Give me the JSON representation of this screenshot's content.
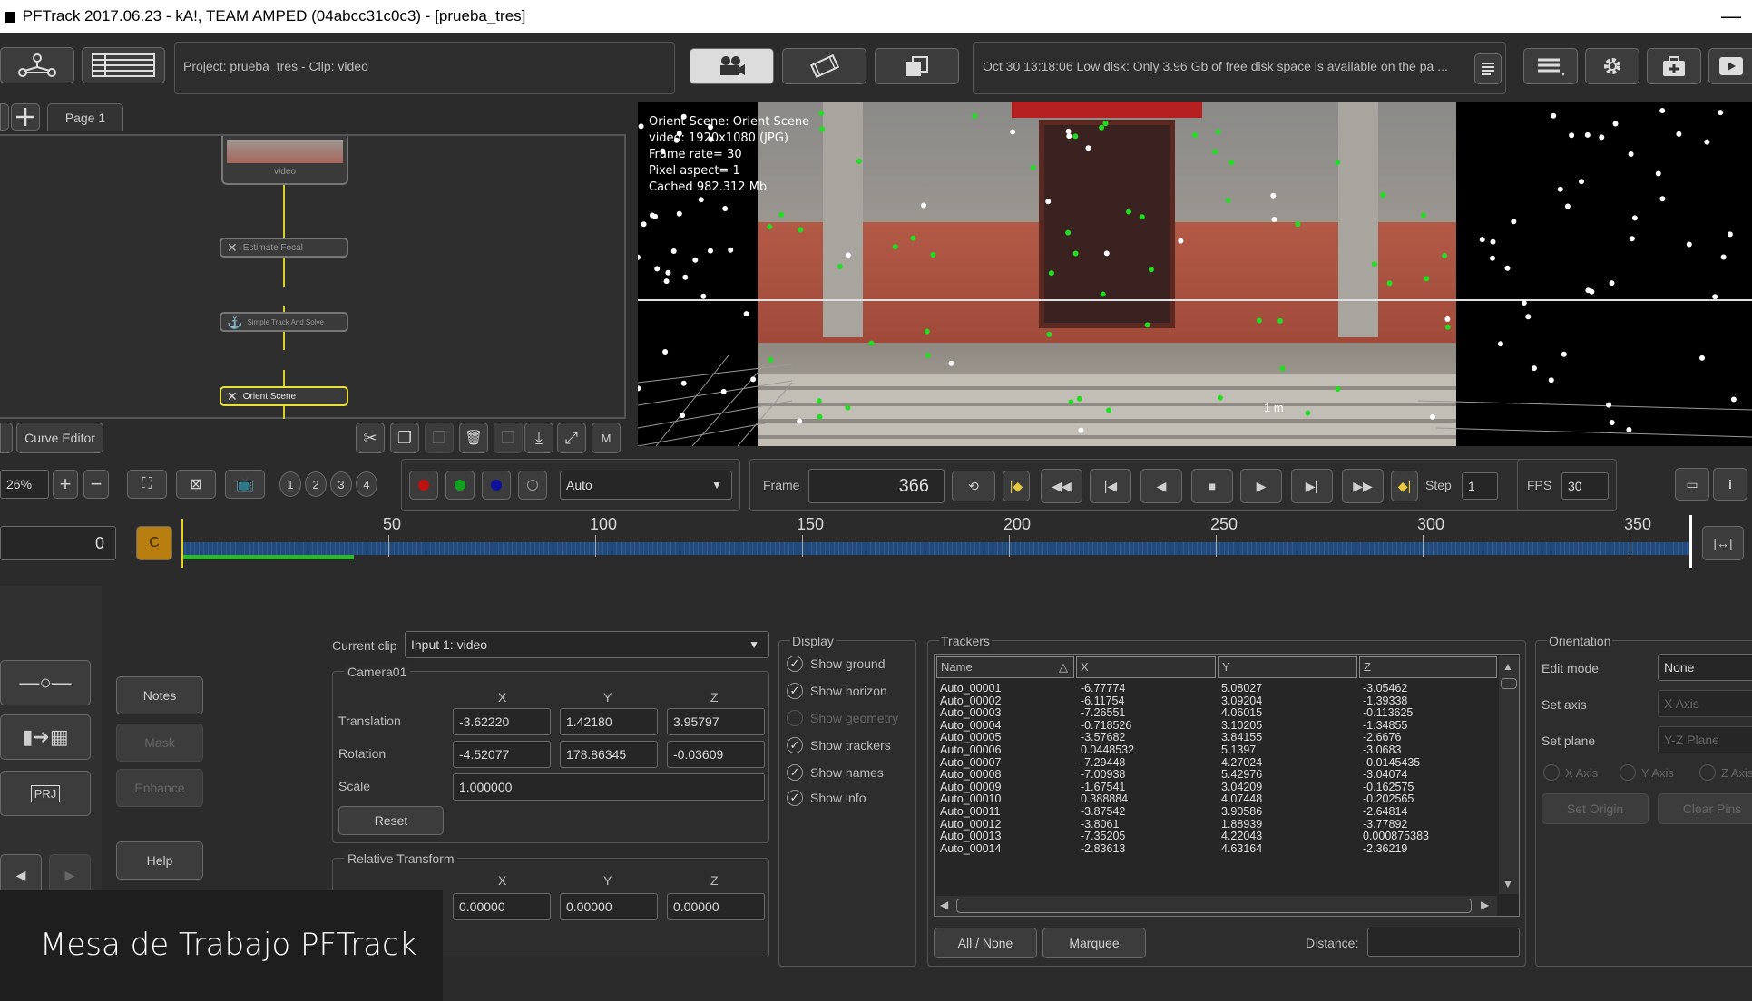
{
  "window": {
    "title": "PFTrack 2017.06.23 - kA!, TEAM AMPED (04abcc31c0c3) - [prueba_tres]",
    "close_glyph": "—"
  },
  "toolbar": {
    "project_info": "Project: prueba_tres - Clip: video",
    "status_message": "Oct 30 13:18:06 Low disk: Only 3.96 Gb of free disk space is available on the pa ..."
  },
  "node_editor": {
    "tab_label": "Page 1",
    "nodes": [
      "video",
      "Estimate Focal",
      "Simple Track And Solve",
      "Orient Scene"
    ],
    "curve_editor_label": "Curve Editor",
    "menu_label": "M"
  },
  "viewport": {
    "info_lines": [
      "Orient Scene: Orient Scene",
      "video: 1920x1080 (JPG)",
      "Frame rate= 30",
      "Pixel aspect= 1",
      "Cached 982.312 Mb"
    ],
    "scale_label": "1 m"
  },
  "transport": {
    "zoom": "26%",
    "layouts": [
      "1",
      "2",
      "3",
      "4"
    ],
    "display_mode": "Auto",
    "frame_label": "Frame",
    "frame_value": "366",
    "step_label": "Step",
    "step_value": "1",
    "fps_label": "FPS",
    "fps_value": "30"
  },
  "timeline": {
    "start_value": "0",
    "cache_button": "C",
    "ticks": [
      "50",
      "100",
      "150",
      "200",
      "250",
      "300",
      "350"
    ]
  },
  "left_buttons": {
    "notes": "Notes",
    "mask": "Mask",
    "enhance": "Enhance",
    "help": "Help",
    "prj": "PRJ"
  },
  "clip_panel": {
    "current_clip_label": "Current clip",
    "current_clip_value": "Input 1: video",
    "camera_group": "Camera01",
    "axes": [
      "X",
      "Y",
      "Z"
    ],
    "translation_label": "Translation",
    "translation": [
      "-3.62220",
      "1.42180",
      "3.95797"
    ],
    "rotation_label": "Rotation",
    "rotation": [
      "-4.52077",
      "178.86345",
      "-0.03609"
    ],
    "scale_label": "Scale",
    "scale": "1.000000",
    "reset_label": "Reset",
    "relative_group": "Relative Transform",
    "relative": [
      "0.00000",
      "0.00000",
      "0.00000"
    ]
  },
  "display_panel": {
    "title": "Display",
    "options": [
      {
        "label": "Show ground",
        "checked": true
      },
      {
        "label": "Show horizon",
        "checked": true
      },
      {
        "label": "Show geometry",
        "checked": false
      },
      {
        "label": "Show trackers",
        "checked": true
      },
      {
        "label": "Show names",
        "checked": true
      },
      {
        "label": "Show info",
        "checked": true
      }
    ]
  },
  "trackers_panel": {
    "title": "Trackers",
    "columns": [
      "Name",
      "X",
      "Y",
      "Z"
    ],
    "rows": [
      [
        "Auto_00001",
        "-6.77774",
        "5.08027",
        "-3.05462"
      ],
      [
        "Auto_00002",
        "-6.11754",
        "3.09204",
        "-1.39338"
      ],
      [
        "Auto_00003",
        "-7.26551",
        "4.06015",
        "-0.113625"
      ],
      [
        "Auto_00004",
        "-0.718526",
        "3.10205",
        "-1.34855"
      ],
      [
        "Auto_00005",
        "-3.57682",
        "3.84155",
        "-2.6676"
      ],
      [
        "Auto_00006",
        "0.0448532",
        "5.1397",
        "-3.0683"
      ],
      [
        "Auto_00007",
        "-7.29448",
        "4.27024",
        "-0.0145435"
      ],
      [
        "Auto_00008",
        "-7.00938",
        "5.42976",
        "-3.04074"
      ],
      [
        "Auto_00009",
        "-1.67541",
        "3.04209",
        "-0.162575"
      ],
      [
        "Auto_00010",
        "0.388884",
        "4.07448",
        "-0.202565"
      ],
      [
        "Auto_00011",
        "-3.87542",
        "3.90586",
        "-2.64814"
      ],
      [
        "Auto_00012",
        "-3.8061",
        "1.88939",
        "-3.77892"
      ],
      [
        "Auto_00013",
        "-7.35205",
        "4.22043",
        "0.000875383"
      ],
      [
        "Auto_00014",
        "-2.83613",
        "4.63164",
        "-2.36219"
      ]
    ],
    "all_none_label": "All / None",
    "marquee_label": "Marquee",
    "distance_label": "Distance:"
  },
  "orientation_panel": {
    "title": "Orientation",
    "edit_mode_label": "Edit mode",
    "edit_mode_value": "None",
    "set_axis_label": "Set axis",
    "set_axis_value": "X Axis",
    "set_plane_label": "Set plane",
    "set_plane_value": "Y-Z Plane",
    "axis_checks": [
      "X Axis",
      "Y Axis",
      "Z Axis"
    ],
    "set_origin_label": "Set Origin",
    "clear_pins_label": "Clear Pins"
  },
  "caption": "Mesa de Trabajo PFTrack"
}
